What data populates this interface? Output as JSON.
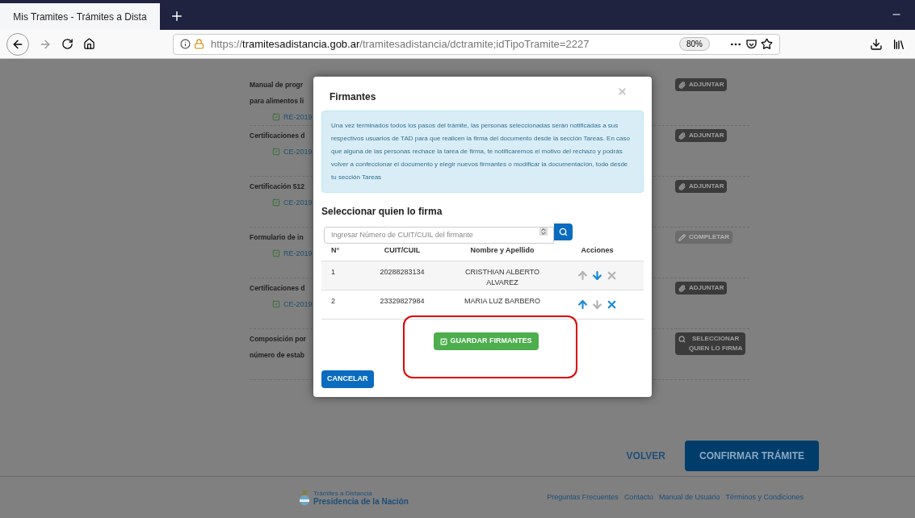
{
  "browser": {
    "tab_title": "Mis Tramites - Trámites a Dista",
    "url_prefix": "https://",
    "url_domain": "tramitesadistancia.gob.ar",
    "url_path": "/tramitesadistancia/dctramite;idTipoTramite=2227",
    "zoom": "80%"
  },
  "documents": [
    {
      "title_lines": [
        "Manual de progr",
        "para alimentos li"
      ],
      "reference": "RE-2019",
      "action": {
        "kind": "adjuntar",
        "label": "ADJUNTAR",
        "disabled": false
      }
    },
    {
      "title_lines": [
        "Certificaciones d"
      ],
      "reference": "CE-2019",
      "action": {
        "kind": "adjuntar",
        "label": "ADJUNTAR",
        "disabled": false
      }
    },
    {
      "title_lines": [
        "Certificación 512"
      ],
      "reference": "CE-2019",
      "action": {
        "kind": "adjuntar",
        "label": "ADJUNTAR",
        "disabled": false
      }
    },
    {
      "title_lines": [
        "Formulario de in"
      ],
      "reference": "RE-2019",
      "action": {
        "kind": "completar",
        "label": "COMPLETAR",
        "disabled": true
      }
    },
    {
      "title_lines": [
        "Certificaciones d"
      ],
      "reference": "CE-2019",
      "action": {
        "kind": "adjuntar",
        "label": "ADJUNTAR",
        "disabled": false
      }
    },
    {
      "title_lines": [
        "Composición por",
        "número de estab"
      ],
      "action": {
        "kind": "seleccionar",
        "label_lines": [
          "SELECCIONAR",
          "QUIEN LO FIRMA"
        ],
        "disabled": false
      }
    }
  ],
  "page_actions": {
    "back": "VOLVER",
    "confirm": "CONFIRMAR TRÁMITE"
  },
  "footer": {
    "brand_top": "Trámites a Distancia",
    "brand_bottom": "Presidencia de la Nación",
    "links": [
      "Preguntas Frecuentes",
      "Contacto",
      "Manual de Usuario",
      "Términos y Condiciones"
    ]
  },
  "modal": {
    "title": "Firmantes",
    "info": "Una vez terminados todos los pasos del trámite, las personas seleccionadas serán notificadas a sus respectivos usuarios de TAD para que realicen la firma del documento desde la sección Tareas. En caso que alguna de las personas rechace la tarea de firma, te notificaremos el motivo del rechazo y podrás volver a confeccionar el documento y elegir nuevos firmantes o modificar la documentación, todo desde tu sección Tareas",
    "section_title": "Seleccionar quien lo firma",
    "search": {
      "placeholder": "Ingresar Número de CUIT/CUIL del firmante"
    },
    "columns": [
      "N°",
      "CUIT/CUIL",
      "Nombre y Apellido",
      "Acciones"
    ],
    "rows": [
      {
        "number": "1",
        "cuit": "20288283134",
        "name_lines": [
          "CRISTHIAN ALBERTO",
          "ALVAREZ"
        ],
        "up_enabled": false,
        "down_enabled": true,
        "remove_enabled": false
      },
      {
        "number": "2",
        "cuit": "23329827984",
        "name_lines": [
          "MARIA LUZ BARBERO"
        ],
        "up_enabled": true,
        "down_enabled": false,
        "remove_enabled": true
      }
    ],
    "save": "GUARDAR FIRMANTES",
    "cancel": "CANCELAR"
  }
}
